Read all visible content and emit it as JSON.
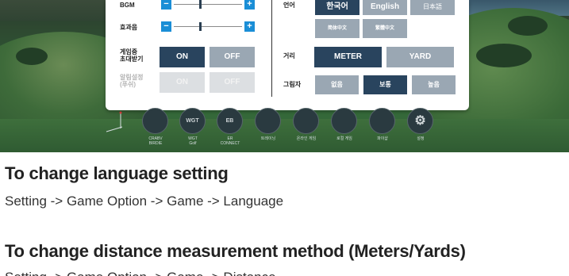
{
  "options_panel": {
    "bgm_label": "BGM",
    "sfx_label": "효과음",
    "invite_label_line1": "게임중",
    "invite_label_line2": "초대받기",
    "invite_on": "ON",
    "invite_off": "OFF",
    "notify_label_line1": "알림설정",
    "notify_label_line2": "(푸쉬)",
    "notify_on": "ON",
    "notify_off": "OFF",
    "language_label": "언어",
    "languages": [
      "한국어",
      "English",
      "日本語",
      "简体中文",
      "繁體中文"
    ],
    "selected_language": "한국어",
    "distance_label": "거리",
    "distance_options": [
      "METER",
      "YARD"
    ],
    "selected_distance": "METER",
    "shadow_label": "그림자",
    "shadow_options": [
      "없음",
      "보통",
      "높음"
    ],
    "selected_shadow": "보통",
    "bgm_level": 0.38,
    "sfx_level": 0.38
  },
  "menu": {
    "items": [
      {
        "label_line1": "CRABV",
        "label_line2": "BIRDIE",
        "icon": "crab-icon"
      },
      {
        "label_line1": "WGT",
        "label_line2": "Golf",
        "icon": "wgt-icon"
      },
      {
        "label_line1": "ER",
        "label_line2": "CONNECT",
        "icon": "er-icon"
      },
      {
        "label_line1": "트레이닝",
        "label_line2": "",
        "icon": "golfer-icon"
      },
      {
        "label_line1": "온라인 게임",
        "label_line2": "",
        "icon": "online-icon"
      },
      {
        "label_line1": "로컬 게임",
        "label_line2": "",
        "icon": "cart-icon"
      },
      {
        "label_line1": "파이샵",
        "label_line2": "",
        "icon": "shop-icon"
      },
      {
        "label_line1": "설정",
        "label_line2": "",
        "icon": "gear-icon"
      }
    ],
    "icon_texts": [
      "",
      "WGT",
      "EB",
      "",
      "",
      "",
      "",
      "⚙"
    ]
  },
  "article": {
    "heading1": "To change language setting",
    "path1": "Setting -> Game Option -> Game -> Language",
    "heading2": "To change distance measurement method (Meters/Yards)",
    "path2": "Setting -> Game Option -> Game -> Distance"
  },
  "colors": {
    "accent_blue": "#1a8ed6",
    "selected_navy": "#29445e",
    "unselected_gray": "#9aa7b3"
  }
}
